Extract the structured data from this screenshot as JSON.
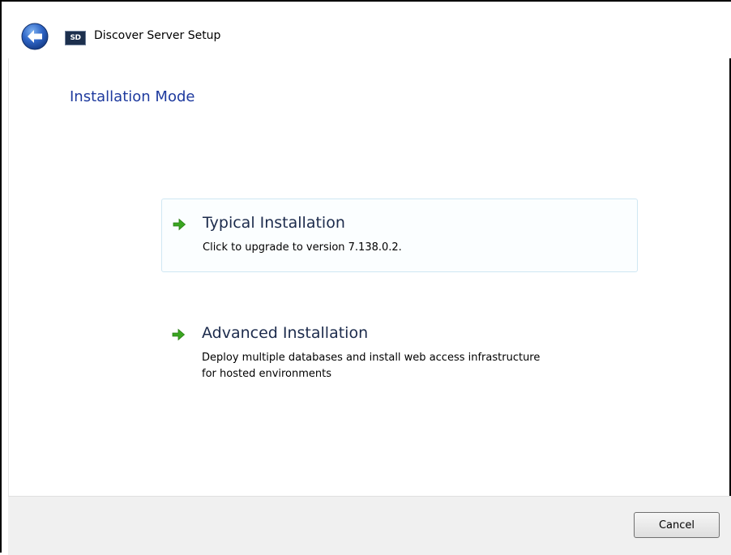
{
  "window": {
    "title": "Discover Server Setup",
    "app_icon_text": "SD"
  },
  "page": {
    "title": "Installation Mode"
  },
  "options": [
    {
      "title": "Typical Installation",
      "description": "Click to upgrade to version 7.138.0.2.",
      "icon": "green-arrow-icon"
    },
    {
      "title": "Advanced Installation",
      "description": "Deploy multiple databases and install web access infrastructure for hosted environments",
      "icon": "green-arrow-icon"
    }
  ],
  "footer": {
    "cancel_label": "Cancel"
  },
  "colors": {
    "page_title": "#1e3a9e",
    "option_title": "#1c2b4c",
    "arrow_green": "#3aa620",
    "back_button_blue": "#2f66c7",
    "highlight_border": "#cfe7f3"
  }
}
